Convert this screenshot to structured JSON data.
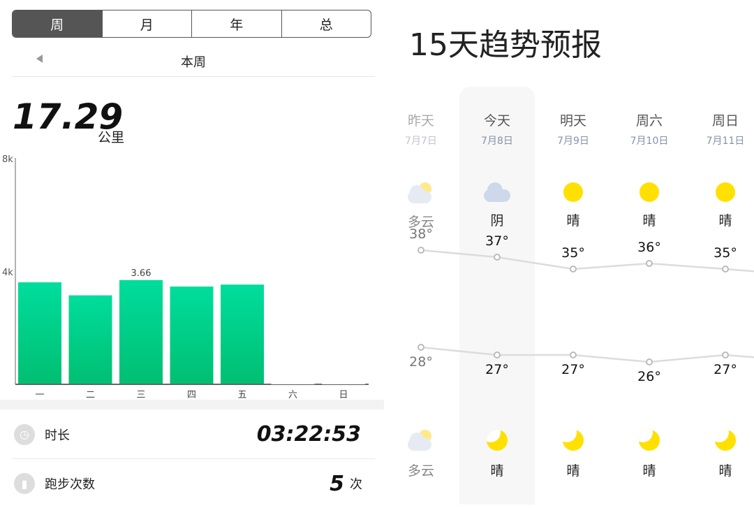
{
  "run": {
    "tabs": [
      "周",
      "月",
      "年",
      "总"
    ],
    "active_tab": "周",
    "period_label": "本周",
    "distance": "17.29",
    "distance_unit": "公里",
    "stats": [
      {
        "icon": "clock-icon",
        "label": "时长",
        "value": "03:22:53",
        "unit": ""
      },
      {
        "icon": "bar-chart-icon",
        "label": "跑步次数",
        "value": "5",
        "unit": "次"
      }
    ]
  },
  "chart_data": {
    "type": "bar",
    "categories": [
      "一",
      "二",
      "三",
      "四",
      "五",
      "六",
      "日"
    ],
    "values": [
      3.58,
      3.12,
      3.66,
      3.43,
      3.5,
      0,
      0
    ],
    "yticks": [
      "4k",
      "8k"
    ],
    "ylim": [
      0,
      8
    ],
    "data_labels": [
      {
        "category": "三",
        "text": "3.66"
      }
    ],
    "bar_color": "#00cc88",
    "grid": false
  },
  "weather": {
    "title": "15天趋势预报",
    "days": [
      {
        "name": "昨天",
        "date": "7月7日",
        "day_cond": "多云",
        "day_icon": "partly-cloudy-icon",
        "high": "38°",
        "low": "28°",
        "night_cond": "多云",
        "night_icon": "partly-cloudy-night-icon",
        "past": true
      },
      {
        "name": "今天",
        "date": "7月8日",
        "day_cond": "阴",
        "day_icon": "cloud-icon",
        "high": "37°",
        "low": "27°",
        "night_cond": "晴",
        "night_icon": "moon-icon",
        "past": false
      },
      {
        "name": "明天",
        "date": "7月9日",
        "day_cond": "晴",
        "day_icon": "sun-icon",
        "high": "35°",
        "low": "27°",
        "night_cond": "晴",
        "night_icon": "moon-icon",
        "past": false
      },
      {
        "name": "周六",
        "date": "7月10日",
        "day_cond": "晴",
        "day_icon": "sun-icon",
        "high": "36°",
        "low": "26°",
        "night_cond": "晴",
        "night_icon": "moon-icon",
        "past": false
      },
      {
        "name": "周日",
        "date": "7月11日",
        "day_cond": "晴",
        "day_icon": "sun-icon",
        "high": "35°",
        "low": "27°",
        "night_cond": "晴",
        "night_icon": "moon-icon",
        "past": false
      }
    ],
    "colors": {
      "sun": "#ffe000",
      "cloud": "#cdd9ea",
      "line": "#dcdcdc"
    }
  }
}
